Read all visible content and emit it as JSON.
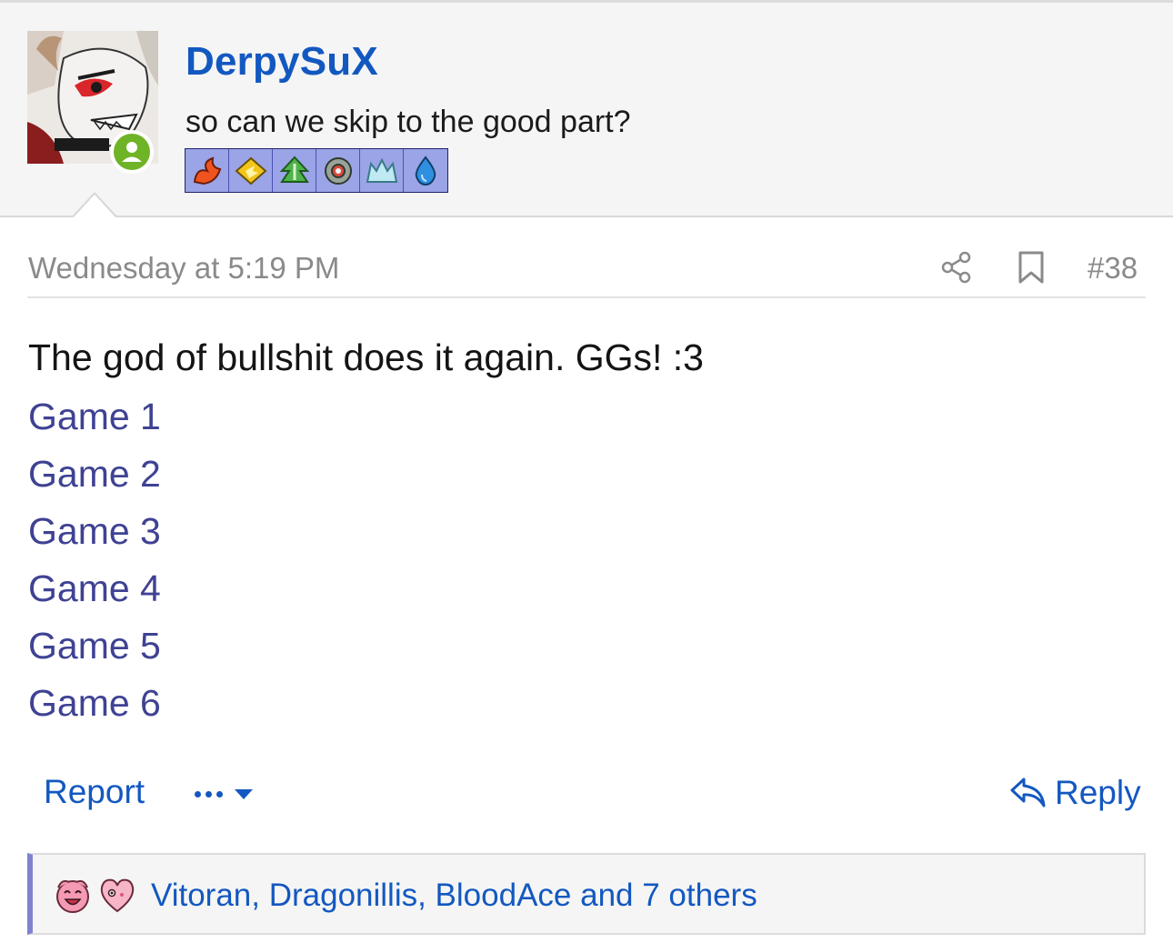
{
  "post": {
    "username": "DerpySuX",
    "user_title": "so can we skip to the good part?",
    "date": "Wednesday at 5:19 PM",
    "post_number": "#38",
    "message": "The god of bullshit does it again. GGs! :3",
    "links": [
      "Game 1",
      "Game 2",
      "Game 3",
      "Game 4",
      "Game 5",
      "Game 6"
    ],
    "type_badges": [
      "fire-type",
      "electric-type",
      "grass-type",
      "steel-type",
      "ice-type",
      "water-type"
    ]
  },
  "actions": {
    "report_label": "Report",
    "reply_label": "Reply"
  },
  "reactions": {
    "names": "Vitoran, Dragonillis, BloodAce and 7 others",
    "icons": [
      "laugh-reaction-icon",
      "love-reaction-icon"
    ]
  },
  "colors": {
    "link": "#1358c0",
    "visited_link": "#3f4293",
    "online": "#6fb326",
    "reaction_accent": "#7f83cf"
  }
}
